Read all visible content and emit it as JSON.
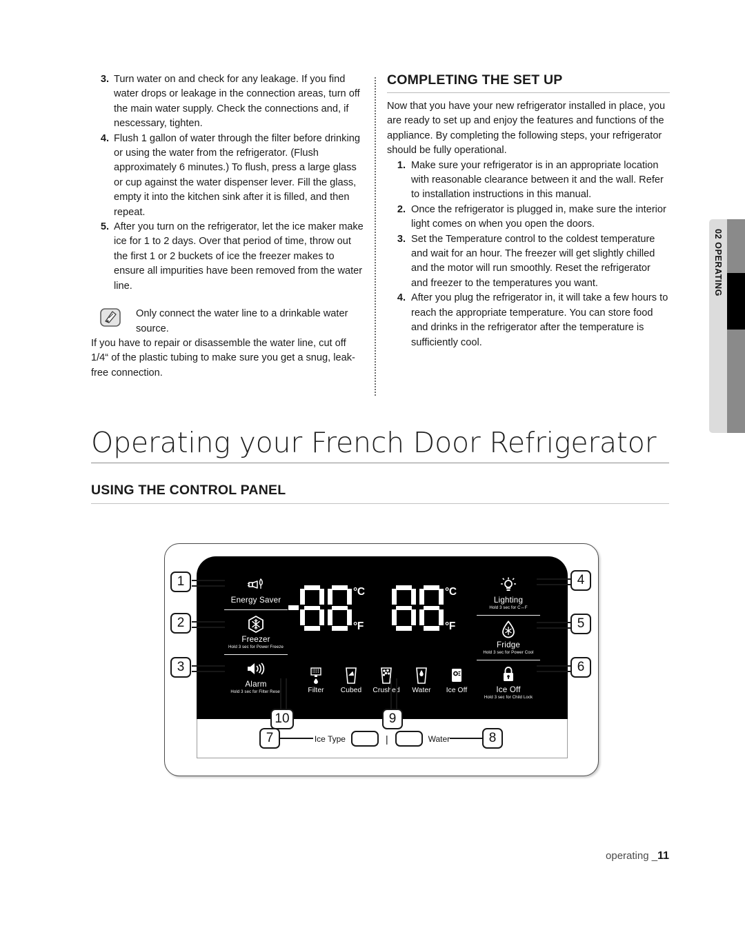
{
  "left_column": {
    "steps": [
      {
        "num": "3.",
        "text": "Turn water on and check for any leakage. If you find water drops or leakage in the connection areas, turn off the main water supply. Check the connections and, if nescessary, tighten."
      },
      {
        "num": "4.",
        "text": "Flush 1 gallon of water through the filter before drinking or using the water from the refrigerator. (Flush approximately 6 minutes.) To flush, press a large glass or cup against the water dispenser lever. Fill the glass, empty it into the kitchen sink after it is filled, and then repeat."
      },
      {
        "num": "5.",
        "text": "After you turn on the refrigerator, let the ice maker make ice for 1 to 2 days. Over that period of time, throw out the first 1 or 2 buckets of ice the freezer makes to ensure all impurities have been removed from the water line."
      }
    ],
    "note": {
      "icon": "note-pen-icon",
      "text": "Only connect the water line to a drinkable water source.",
      "following_text": "If you have to repair or disassemble the water line, cut off 1/4“ of the plastic tubing to make sure you get a snug, leak-free connection."
    }
  },
  "right_column": {
    "heading": "COMPLETING THE SET UP",
    "intro": "Now that you have your new refrigerator installed in place, you are ready to set up and enjoy the features and functions of the appliance. By completing the following steps, your refrigerator should be fully operational.",
    "steps": [
      {
        "num": "1.",
        "text": "Make sure your refrigerator is in an appropriate location with reasonable clearance between it and the wall. Refer to installation instructions in this manual."
      },
      {
        "num": "2.",
        "text": "Once the refrigerator is plugged in, make sure the interior light comes on when you open the doors."
      },
      {
        "num": "3.",
        "text": "Set the Temperature control to the coldest temperature and wait for an hour. The freezer will get slightly chilled and the motor will run smoothly. Reset the refrigerator and freezer to the temperatures you want."
      },
      {
        "num": "4.",
        "text": "After you plug the refrigerator in, it will take a few hours to reach the appropriate temperature. You can store food and drinks in the refrigerator after the temperature is sufficiently cool."
      }
    ]
  },
  "edge_tab": {
    "label": "02  OPERATING"
  },
  "chapter": {
    "title": "Operating your French Door Refrigerator",
    "section_heading": "USING THE CONTROL PANEL"
  },
  "control_panel": {
    "left_buttons": [
      {
        "icon": "energy-saver-icon",
        "label": "Energy Saver",
        "sub": ""
      },
      {
        "icon": "snowflake-icon",
        "label": "Freezer",
        "sub": "Hold 3 sec for Power Freeze"
      },
      {
        "icon": "alarm-speaker-icon",
        "label": "Alarm",
        "sub": "Hold 3 sec for Filter Reset"
      }
    ],
    "right_buttons": [
      {
        "icon": "lighting-bulb-icon",
        "label": "Lighting",
        "sub": "Hold 3 sec for C↔F"
      },
      {
        "icon": "fridge-droplet-icon",
        "label": "Fridge",
        "sub": "Hold 3 sec for Power Cool"
      },
      {
        "icon": "child-lock-icon",
        "label": "Ice Off",
        "sub": "Hold 3 sec for Child Lock"
      }
    ],
    "displays": [
      {
        "name": "freezer-temp-display",
        "sign": "-",
        "digits": "88",
        "units": [
          "°C",
          "°F"
        ]
      },
      {
        "name": "fridge-temp-display",
        "sign": "",
        "digits": "88",
        "units": [
          "°C",
          "°F"
        ]
      }
    ],
    "dispenser_icons": [
      {
        "icon": "filter-icon",
        "label": "Filter"
      },
      {
        "icon": "cubed-ice-icon",
        "label": "Cubed"
      },
      {
        "icon": "crushed-ice-icon",
        "label": "Crushed"
      },
      {
        "icon": "water-glass-icon",
        "label": "Water"
      },
      {
        "icon": "ice-off-icon",
        "label": "Ice Off"
      }
    ],
    "bottom_controls": {
      "ice_type_label": "Ice Type",
      "separator": "|",
      "water_label": "Water"
    },
    "callouts": [
      "1",
      "2",
      "3",
      "4",
      "5",
      "6",
      "7",
      "8",
      "9",
      "10"
    ]
  },
  "footer": {
    "text": "operating _",
    "page": "11"
  }
}
